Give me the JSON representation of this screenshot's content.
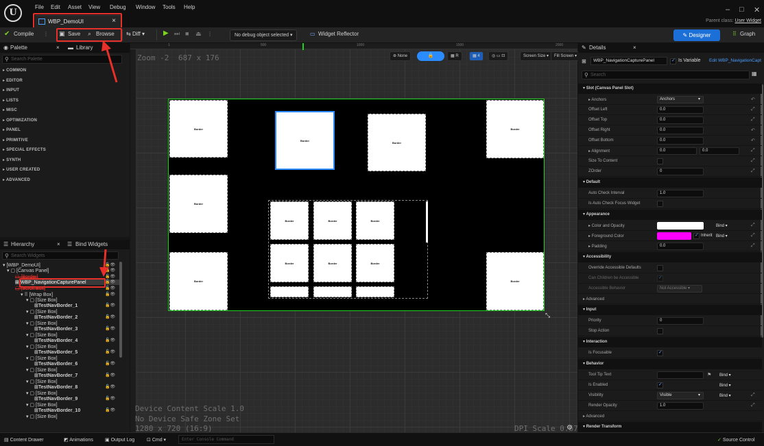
{
  "menu": [
    "File",
    "Edit",
    "Asset",
    "View",
    "Debug",
    "Window",
    "Tools",
    "Help"
  ],
  "doc_tab": {
    "title": "WBP_DemoUI",
    "close": "×"
  },
  "window": {
    "minimize": "–",
    "maximize": "□",
    "close": "✕",
    "parent_class_label": "Parent class:",
    "parent_class": "User Widget"
  },
  "toolbar": {
    "compile": "Compile",
    "save": "Save",
    "browse": "Browse",
    "diff": "Diff",
    "debug_select": "No debug object selected",
    "widget_reflector": "Widget Reflector",
    "designer": "Designer",
    "graph": "Graph"
  },
  "palette": {
    "tab": "Palette",
    "tab2": "Library",
    "close": "×",
    "search_placeholder": "Search Palette",
    "categories": [
      "COMMON",
      "EDITOR",
      "INPUT",
      "LISTS",
      "MISC",
      "OPTIMIZATION",
      "PANEL",
      "PRIMITIVE",
      "SPECIAL EFFECTS",
      "SYNTH",
      "USER CREATED",
      "ADVANCED"
    ]
  },
  "hierarchy": {
    "tab": "Hierarchy",
    "tab2": "Bind Widgets",
    "close": "×",
    "search_placeholder": "Search Widgets",
    "items": [
      "[WBP_DemoUI]",
      "[Canvas Panel]",
      "[Border]",
      "WBP_NavigationCapturePanel",
      "[Scroll Box]",
      "[Wrap Box]",
      "[Size Box]",
      "TestNavBorder_1",
      "[Size Box]",
      "TestNavBorder_2",
      "[Size Box]",
      "TestNavBorder_3",
      "[Size Box]",
      "TestNavBorder_4",
      "[Size Box]",
      "TestNavBorder_5",
      "[Size Box]",
      "TestNavBorder_6",
      "[Size Box]",
      "TestNavBorder_7",
      "[Size Box]",
      "TestNavBorder_8",
      "[Size Box]",
      "TestNavBorder_9",
      "[Size Box]",
      "TestNavBorder_10",
      "[Size Box]"
    ]
  },
  "viewport": {
    "zoom": "Zoom -2",
    "size": "687 x 176",
    "none": "None",
    "r_label": "R",
    "grid_num": "4",
    "screen_size": "Screen Size",
    "fill_screen": "Fill Screen",
    "ruler": [
      "1",
      "500",
      "1000",
      "1500",
      "2000"
    ],
    "dev_scale": "Device Content Scale 1.0",
    "safe_zone": "No Device Safe Zone Set",
    "resolution": "1280 x 720 (16:9)",
    "dpi": "DPI Scale 0.67",
    "border_label": "Border"
  },
  "details": {
    "tab": "Details",
    "close": "×",
    "widget": "WBP_NavigationCapturePanel",
    "is_variable": "Is Variable",
    "edit_link": "Edit WBP_NavigationCapt",
    "search_placeholder": "Search",
    "slot_section": "Slot (Canvas Panel Slot)",
    "anchors": "Anchors",
    "anchors_val": "Anchors",
    "offset_left": "Offset Left",
    "offset_top": "Offset Top",
    "offset_right": "Offset Right",
    "offset_bottom": "Offset Bottom",
    "zero": "0.0",
    "alignment": "Alignment",
    "size_to_content": "Size To Content",
    "zorder": "ZOrder",
    "zorder_val": "0",
    "default_section": "Default",
    "auto_check": "Auto Check Interval",
    "auto_check_val": "1.0",
    "is_auto_check": "Is Auto Check Focus Widget",
    "appearance_section": "Appearance",
    "color_opacity": "Color and Opacity",
    "foreground": "Foreground Color",
    "inherit": "Inherit",
    "padding": "Padding",
    "bind": "Bind",
    "accessibility_section": "Accessibility",
    "override_acc": "Override Accessible Defaults",
    "children_acc": "Can Children be Accessible",
    "acc_behavior": "Accessible Behavior",
    "not_accessible": "Not Accessible",
    "advanced": "Advanced",
    "input_section": "Input",
    "priority": "Priority",
    "priority_val": "0",
    "stop_action": "Stop Action",
    "interaction_section": "Interaction",
    "is_focusable": "Is Focusable",
    "behavior_section": "Behavior",
    "tooltip": "Tool Tip Text",
    "is_enabled": "Is Enabled",
    "visibility": "Visibility",
    "visible": "Visible",
    "render_opacity": "Render Opacity",
    "render_opacity_val": "1.0",
    "advanced2": "Advanced",
    "render_transform": "Render Transform",
    "colors": {
      "color_opacity": "#ffffff",
      "foreground": "#ff00ff"
    }
  },
  "bottom": {
    "content_drawer": "Content Drawer",
    "animations": "Animations",
    "output_log": "Output Log",
    "cmd": "Cmd",
    "console_placeholder": "Enter Console Command",
    "source_control": "Source Control"
  }
}
